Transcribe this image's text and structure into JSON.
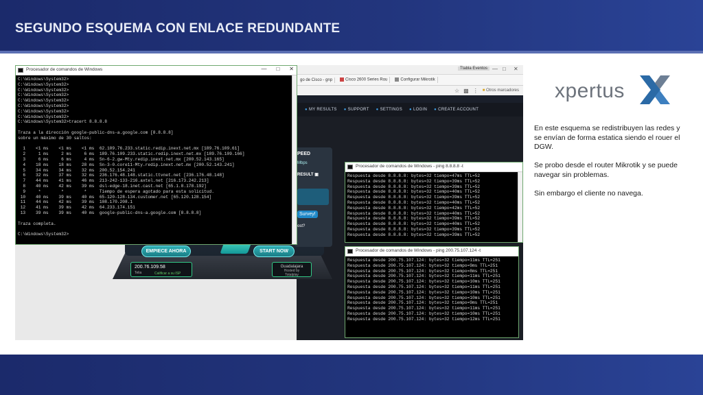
{
  "slide": {
    "title": "SEGUNDO ESQUEMA CON ENLACE REDUNDANTE",
    "logo_text": "xpertus",
    "paragraphs": [
      "En este esquema se redistribuyen las redes y se envían de forma estatica siendo el rouer el DGW.",
      "Se probo desde el router Mikrotik y se puede navegar sin problemas.",
      "Sin embargo el cliente no navega."
    ]
  },
  "browser": {
    "top_label": "Ttabla Eventos",
    "tabs": [
      "go de Cisco - gnp",
      "Cisco 2600 Series Rou",
      "Configurar Mikrotik"
    ],
    "toolbar_right": "Otros marcadores",
    "site_menu": [
      "MY RESULTS",
      "SUPPORT",
      "SETTINGS",
      "LOGIN",
      "CREATE ACCOUNT"
    ]
  },
  "speedtest": {
    "speed_label": "PEED",
    "mbps": "Mbps",
    "result_label": "RESULT",
    "survey": "Survey!",
    "ost": "ost?",
    "begin_button": "EMPIECE AHORA",
    "start_button": "START NOW",
    "ip": "200.76.109.58",
    "isp": "Telia",
    "rate": "Calificar a su ISP",
    "server_city": "Guadalajara",
    "server_host": "Hosted by",
    "server_host2": "Totalplay"
  },
  "cmd_main": {
    "title": "Procesador de comandos de Windows",
    "lines": [
      "C:\\Windows\\System32>",
      "C:\\Windows\\System32>",
      "C:\\Windows\\System32>",
      "C:\\Windows\\System32>",
      "C:\\Windows\\System32>",
      "C:\\Windows\\System32>",
      "C:\\Windows\\System32>",
      "C:\\Windows\\System32>",
      "C:\\Windows\\System32>tracert 8.8.8.8",
      "",
      "Traza a la dirección google-public-dns-a.google.com [8.8.8.8]",
      "sobre un máximo de 30 saltos:",
      "",
      "  1    <1 ms    <1 ms    <1 ms  62.109.76.233.static.redip.inext.net.mx [189.76.109.61]",
      "  2     1 ms     2 ms     6 ms  189.76.109.233.static.redip.inext.net.mx [189.76.109.166]",
      "  3     6 ms     6 ms     4 ms  Sn-6-2.gw-Mty.redip.inext.net.mx [200.52.143.165]",
      "  4    18 ms    18 ms    28 ms  Sn-3-0.core11-Mty.redip.inext.net.mx [200.52.143.241]",
      "  5    34 ms    34 ms    32 ms  200.52.154.241",
      "  6    32 ms    37 ms    32 ms  236.176.48.148.static.ttvnet.net [236.176.48.148]",
      "  7    44 ms    41 ms    46 ms  213-242-133-216.axtel.net [216.173.242.213]",
      "  8    40 ms    42 ms    39 ms  dsl-edge-18.inet.cast.net [65.1.8.178.192]",
      "  9     *        *        *     Tiempo de espera agotado para esta solicitud.",
      " 10    40 ms    39 ms    40 ms  65-120-128-134.customer.net [65.120.128.154]",
      " 11    44 ms    42 ms    39 ms  108.170.208.1",
      " 12    41 ms    39 ms    42 ms  64.233.174.151",
      " 13    39 ms    39 ms    40 ms  google-public-dns-a.google.com [8.8.8.8]",
      "",
      "Traza completa.",
      "",
      "C:\\Windows\\System32>"
    ]
  },
  "cmd_ping1": {
    "title": "Procesador de comandos de Windows - ping 8.8.8.8 -t",
    "lines": [
      "Respuesta desde 8.8.8.8: bytes=32 tiempo=47ms TTL=52",
      "Respuesta desde 8.8.8.8: bytes=32 tiempo=39ms TTL=52",
      "Respuesta desde 8.8.8.8: bytes=32 tiempo=39ms TTL=52",
      "Respuesta desde 8.8.8.8: bytes=32 tiempo=40ms TTL=52",
      "Respuesta desde 8.8.8.8: bytes=32 tiempo=39ms TTL=52",
      "Respuesta desde 8.8.8.8: bytes=32 tiempo=40ms TTL=52",
      "Respuesta desde 8.8.8.8: bytes=32 tiempo=42ms TTL=52",
      "Respuesta desde 8.8.8.8: bytes=32 tiempo=40ms TTL=52",
      "Respuesta desde 8.8.8.8: bytes=32 tiempo=39ms TTL=52",
      "Respuesta desde 8.8.8.8: bytes=32 tiempo=40ms TTL=52",
      "Respuesta desde 8.8.8.8: bytes=32 tiempo=39ms TTL=52",
      "Respuesta desde 8.8.8.8: bytes=32 tiempo=39ms TTL=52"
    ]
  },
  "cmd_ping2": {
    "title": "Procesador de comandos de Windows - ping 200.75.107.124 -t",
    "lines": [
      "Respuesta desde 200.75.107.124: bytes=32 tiempo=11ms TTL=251",
      "Respuesta desde 200.75.107.124: bytes=32 tiempo=9ms TTL=251",
      "Respuesta desde 200.75.107.124: bytes=32 tiempo=8ms TTL=251",
      "Respuesta desde 200.75.107.124: bytes=32 tiempo=11ms TTL=251",
      "Respuesta desde 200.75.107.124: bytes=32 tiempo=10ms TTL=251",
      "Respuesta desde 200.75.107.124: bytes=32 tiempo=11ms TTL=251",
      "Respuesta desde 200.75.107.124: bytes=32 tiempo=10ms TTL=251",
      "Respuesta desde 200.75.107.124: bytes=32 tiempo=10ms TTL=251",
      "Respuesta desde 200.75.107.124: bytes=32 tiempo=9ms TTL=251",
      "Respuesta desde 200.75.107.124: bytes=32 tiempo=11ms TTL=251",
      "Respuesta desde 200.75.107.124: bytes=32 tiempo=10ms TTL=251",
      "Respuesta desde 200.75.107.124: bytes=32 tiempo=12ms TTL=251"
    ]
  }
}
